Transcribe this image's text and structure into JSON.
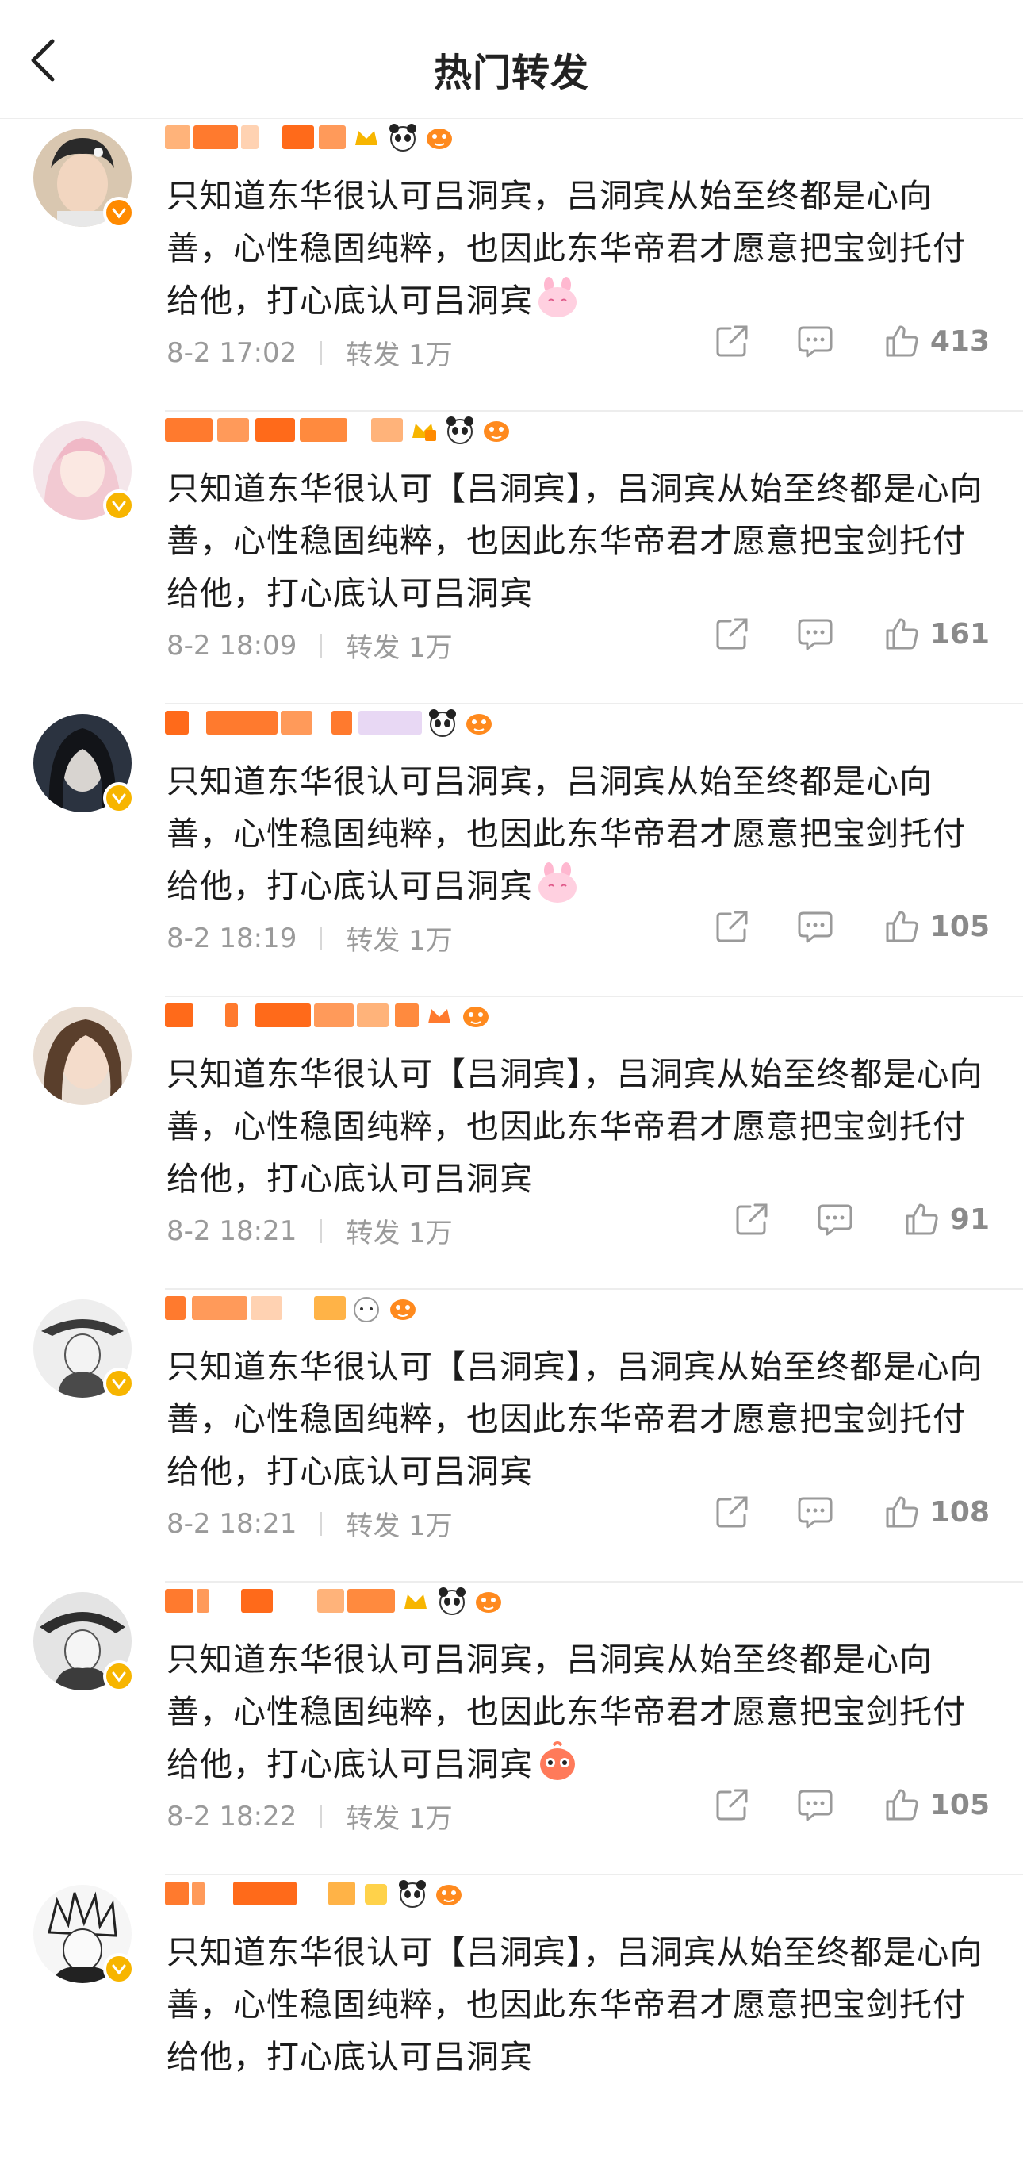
{
  "header": {
    "title": "热门转发",
    "back_icon": "chevron-left-icon"
  },
  "colors": {
    "accent": "#ff8a00",
    "badge_gold": "#f7b500",
    "meta_gray": "#9a9a9a"
  },
  "posts": [
    {
      "content": "只知道东华很认可吕洞宾，吕洞宾从始至终都是心向善，心性稳固纯粹，也因此东华帝君才愿意把宝剑托付给他，打心底认可吕洞宾",
      "emoji": "pink-bunny-emoji",
      "date": "8-2 17:02",
      "repost": "转发 1万",
      "likes": "413"
    },
    {
      "content": "只知道东华很认可【吕洞宾】，吕洞宾从始至终都是心向善，心性稳固纯粹，也因此东华帝君才愿意把宝剑托付给他，打心底认可吕洞宾",
      "emoji": "",
      "date": "8-2 18:09",
      "repost": "转发 1万",
      "likes": "161"
    },
    {
      "content": "只知道东华很认可吕洞宾，吕洞宾从始至终都是心向善，心性稳固纯粹，也因此东华帝君才愿意把宝剑托付给他，打心底认可吕洞宾",
      "emoji": "pink-bunny-emoji",
      "date": "8-2 18:19",
      "repost": "转发 1万",
      "likes": "105"
    },
    {
      "content": "只知道东华很认可【吕洞宾】，吕洞宾从始至终都是心向善，心性稳固纯粹，也因此东华帝君才愿意把宝剑托付给他，打心底认可吕洞宾",
      "emoji": "",
      "date": "8-2 18:21",
      "repost": "转发 1万",
      "likes": "91"
    },
    {
      "content": "只知道东华很认可【吕洞宾】，吕洞宾从始至终都是心向善，心性稳固纯粹，也因此东华帝君才愿意把宝剑托付给他，打心底认可吕洞宾",
      "emoji": "",
      "date": "8-2 18:21",
      "repost": "转发 1万",
      "likes": "108"
    },
    {
      "content": "只知道东华很认可吕洞宾，吕洞宾从始至终都是心向善，心性稳固纯粹，也因此东华帝君才愿意把宝剑托付给他，打心底认可吕洞宾",
      "emoji": "orange-bird-emoji",
      "date": "8-2 18:22",
      "repost": "转发 1万",
      "likes": "105"
    },
    {
      "content": "只知道东华很认可【吕洞宾】，吕洞宾从始至终都是心向善，心性稳固纯粹，也因此东华帝君才愿意把宝剑托付给他，打心底认可吕洞宾",
      "emoji": "",
      "date": "",
      "repost": "",
      "likes": ""
    }
  ]
}
